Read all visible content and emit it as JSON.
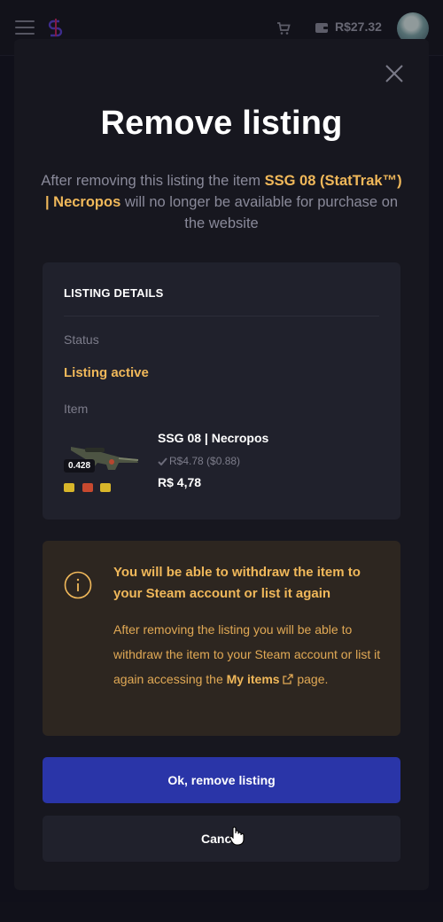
{
  "header": {
    "balance": "R$27.32",
    "icons": [
      "hamburger-menu-icon",
      "logo-icon",
      "cart-icon",
      "wallet-icon",
      "avatar"
    ]
  },
  "modal": {
    "title": "Remove listing",
    "description_pre": "After removing this listing the item ",
    "description_item": "SSG 08 (StatTrak™) | Necropos",
    "description_post": " will no longer be available for purchase on the website",
    "details": {
      "heading": "LISTING DETAILS",
      "status_label": "Status",
      "status_value": "Listing active",
      "item_label": "Item",
      "float": "0.428",
      "item_name": "SSG 08 | Necropos",
      "item_sub": "R$4.78 ($0.88)",
      "item_price": "R$ 4,78"
    },
    "notice": {
      "title": "You will be able to withdraw the item to your Steam account or list it again",
      "text_pre": "After removing the listing you will be able to withdraw the item to your Steam account or list it again accessing the ",
      "link": "My items",
      "text_post": " page."
    },
    "confirm_label": "Ok, remove listing",
    "cancel_label": "Cancel"
  },
  "colors": {
    "accent": "#f0b85a",
    "primary_button": "#2a35a8",
    "background": "#15151f"
  }
}
